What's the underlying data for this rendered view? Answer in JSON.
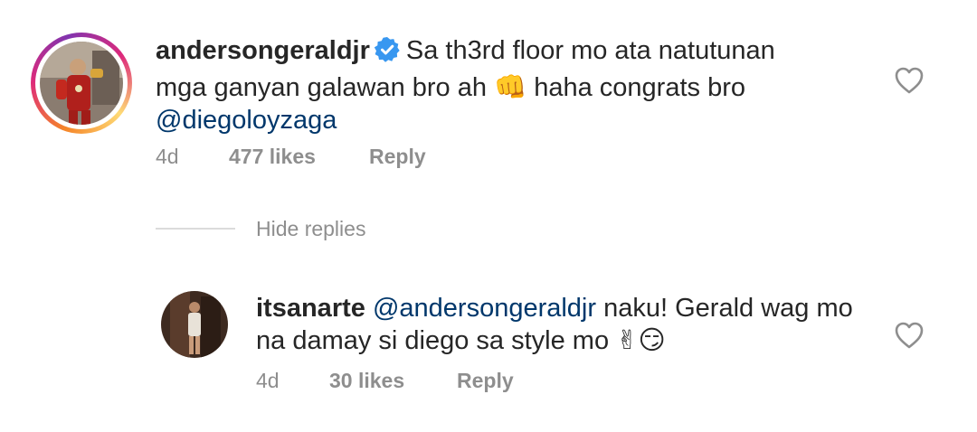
{
  "comment": {
    "username": "andersongeraldjr",
    "text_line1": "Sa th3rd floor mo ata natutunan",
    "text_line2a": "mga ganyan galawan bro ah",
    "text_line2_emoji": "👊",
    "text_line2b": "haha congrats bro",
    "mention": "@diegoloyzaga",
    "time": "4d",
    "likes": "477 likes",
    "reply_label": "Reply"
  },
  "replies_toggle": "Hide replies",
  "reply": {
    "username": "itsanarte",
    "mention": "@andersongeraldjr",
    "text_line1": "naku! Gerald wag mo",
    "text_line2": "na damay si diego sa style mo",
    "emojis": "✌😏",
    "time": "4d",
    "likes": "30 likes",
    "reply_label": "Reply"
  },
  "colors": {
    "text": "#262626",
    "muted": "#8e8e8e",
    "mention": "#00376b",
    "verified": "#3897f0"
  },
  "icons": [
    "verified-badge-icon",
    "heart-icon"
  ]
}
